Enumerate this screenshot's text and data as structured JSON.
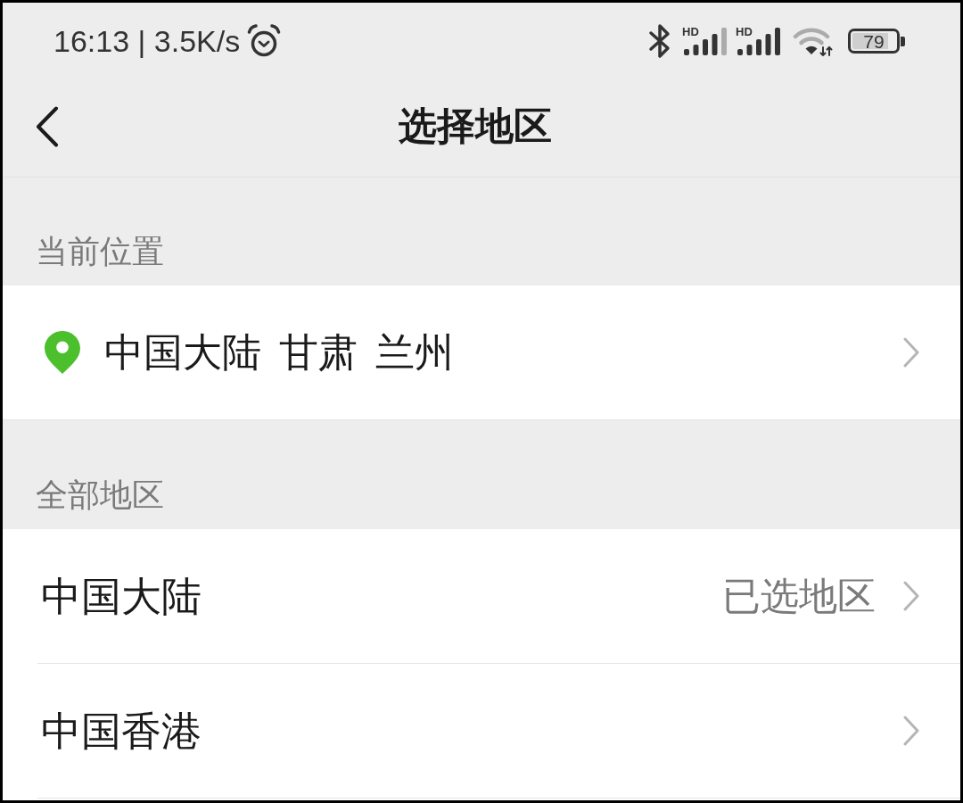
{
  "status_bar": {
    "clock": "16:13 | 3.5K/s",
    "signals": [
      {
        "label": "HD",
        "kind": "partial"
      },
      {
        "label": "HD",
        "kind": "full"
      }
    ],
    "battery": "79"
  },
  "nav_bar": {
    "title": "选择地区"
  },
  "current_location": {
    "header": "当前位置",
    "location": "中国大陆 甘肃 兰州"
  },
  "all_regions": {
    "header": "全部地区",
    "items": [
      {
        "name": "中国大陆",
        "value": "已选地区"
      },
      {
        "name": "中国香港"
      }
    ]
  }
}
